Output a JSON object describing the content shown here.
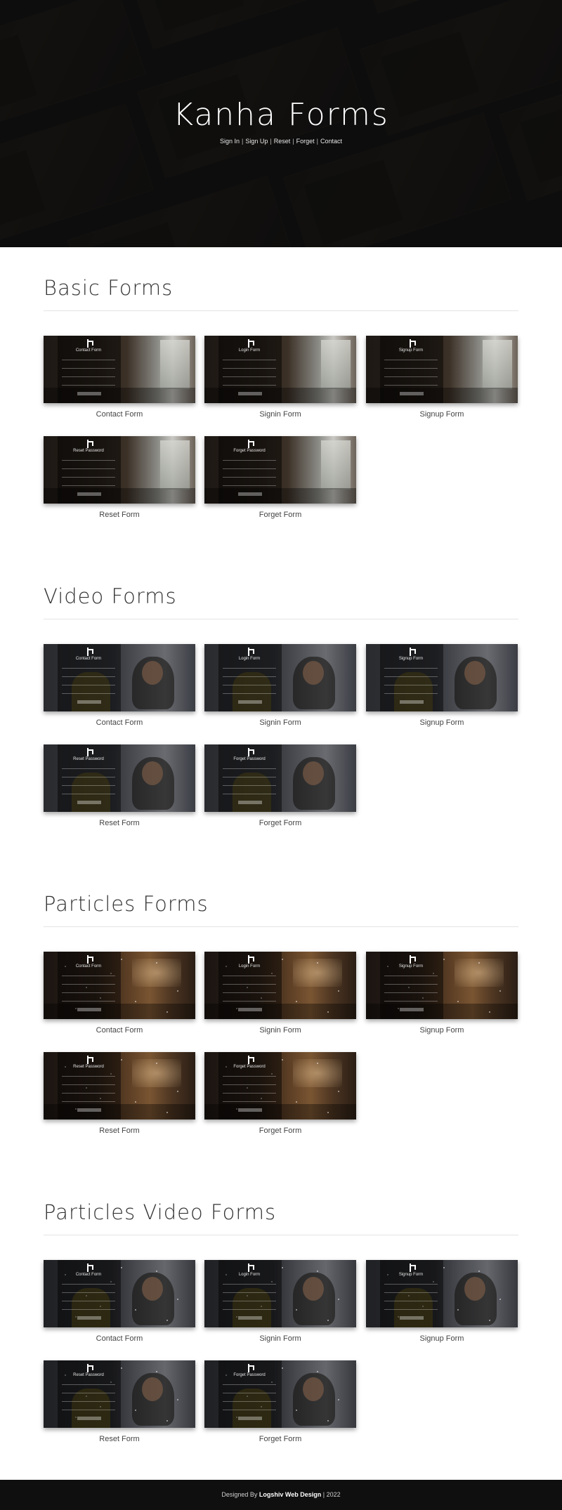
{
  "hero": {
    "title": "Kanha Forms",
    "links": [
      "Sign In",
      "Sign Up",
      "Reset",
      "Forget",
      "Contact"
    ],
    "separator": "|"
  },
  "sections": [
    {
      "title": "Basic Forms",
      "theme": "basic",
      "cards": [
        {
          "label": "Contact Form",
          "thumb_title": "Contact Form"
        },
        {
          "label": "Signin Form",
          "thumb_title": "Login Form"
        },
        {
          "label": "Signup Form",
          "thumb_title": "Signup Form"
        },
        {
          "label": "Reset Form",
          "thumb_title": "Reset Password"
        },
        {
          "label": "Forget Form",
          "thumb_title": "Forget Password"
        }
      ]
    },
    {
      "title": "Video Forms",
      "theme": "video",
      "cards": [
        {
          "label": "Contact Form",
          "thumb_title": "Contact Form"
        },
        {
          "label": "Signin Form",
          "thumb_title": "Login Form"
        },
        {
          "label": "Signup Form",
          "thumb_title": "Signup Form"
        },
        {
          "label": "Reset Form",
          "thumb_title": "Reset Password"
        },
        {
          "label": "Forget Form",
          "thumb_title": "Forget Password"
        }
      ]
    },
    {
      "title": "Particles Forms",
      "theme": "particles",
      "cards": [
        {
          "label": "Contact Form",
          "thumb_title": "Contact Form"
        },
        {
          "label": "Signin Form",
          "thumb_title": "Login Form"
        },
        {
          "label": "Signup Form",
          "thumb_title": "Signup Form"
        },
        {
          "label": "Reset Form",
          "thumb_title": "Reset Password"
        },
        {
          "label": "Forget Form",
          "thumb_title": "Forget Password"
        }
      ]
    },
    {
      "title": "Particles Video Forms",
      "theme": "pvideo",
      "cards": [
        {
          "label": "Contact Form",
          "thumb_title": "Contact Form"
        },
        {
          "label": "Signin Form",
          "thumb_title": "Login Form"
        },
        {
          "label": "Signup Form",
          "thumb_title": "Signup Form"
        },
        {
          "label": "Reset Form",
          "thumb_title": "Reset Password"
        },
        {
          "label": "Forget Form",
          "thumb_title": "Forget Password"
        }
      ]
    }
  ],
  "footer": {
    "prefix": "Designed By",
    "brand": "Logshiv Web Design",
    "suffix": "| 2022"
  }
}
